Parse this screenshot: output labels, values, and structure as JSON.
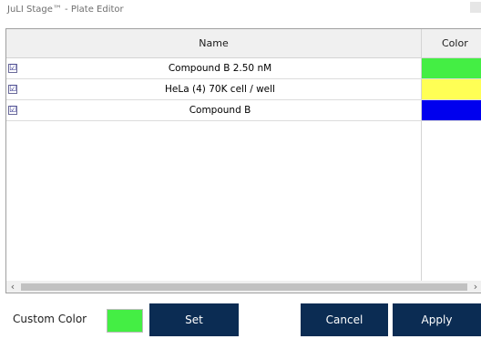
{
  "window": {
    "title": "JuLI Stage™ - Plate Editor"
  },
  "table": {
    "columns": {
      "name": "Name",
      "color": "Color"
    },
    "rows": [
      {
        "name": "Compound B  2.50 nM",
        "checked": true,
        "check_glyph": "☑",
        "color": "#44ee44"
      },
      {
        "name": "HeLa (4) 70K cell / well",
        "checked": true,
        "check_glyph": "☑",
        "color": "#ffff55"
      },
      {
        "name": "Compound B",
        "checked": true,
        "check_glyph": "☑",
        "color": "#0000ee"
      }
    ]
  },
  "scrollbar": {
    "left_arrow": "‹",
    "right_arrow": "›"
  },
  "footer": {
    "custom_color_label": "Custom Color",
    "custom_color_value": "#44ee44",
    "set_label": "Set",
    "cancel_label": "Cancel",
    "apply_label": "Apply"
  },
  "colors": {
    "button_bg": "#0b2c53",
    "header_bg": "#f0f0f0"
  }
}
